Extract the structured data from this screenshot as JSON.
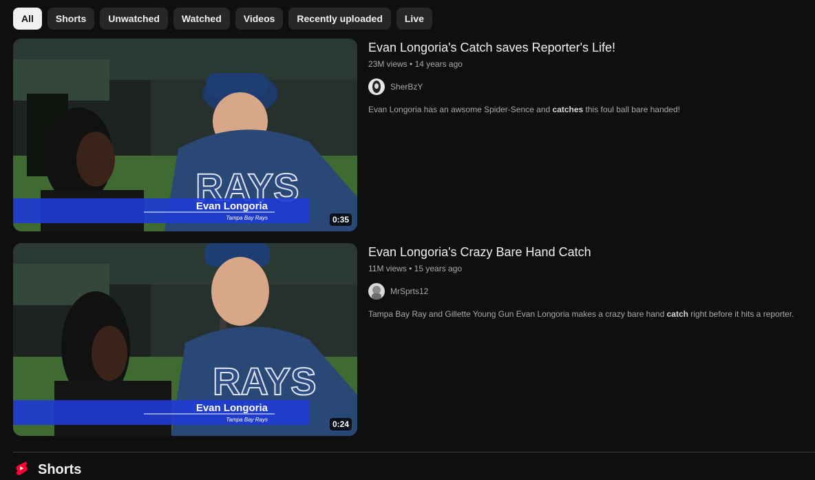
{
  "filters": [
    "All",
    "Shorts",
    "Unwatched",
    "Watched",
    "Videos",
    "Recently uploaded",
    "Live"
  ],
  "active_filter": "All",
  "results": [
    {
      "title": "Evan Longoria's Catch saves Reporter's Life!",
      "views": "23M views",
      "age": "14 years ago",
      "channel": "SherBzY",
      "duration": "0:35",
      "desc_parts": [
        "Evan Longoria has an awsome Spider-Sence and ",
        "catches",
        " this foul ball bare handed!"
      ],
      "lower_third_name": "Evan Longoria",
      "lower_third_team": "Tampa Bay Rays"
    },
    {
      "title": "Evan Longoria's Crazy Bare Hand Catch",
      "views": "11M views",
      "age": "15 years ago",
      "channel": "MrSprts12",
      "duration": "0:24",
      "desc_parts": [
        "Tampa Bay Ray and Gillette Young Gun Evan Longoria makes a crazy bare hand ",
        "catch",
        " right before it hits a reporter."
      ],
      "lower_third_name": "Evan Longoria",
      "lower_third_team": "Tampa Bay Rays"
    }
  ],
  "shorts_section_title": "Shorts",
  "colors": {
    "background": "#0f0f0f",
    "chip": "#272727",
    "chip_active": "#f1f1f1",
    "shorts_red": "#ff0033"
  }
}
